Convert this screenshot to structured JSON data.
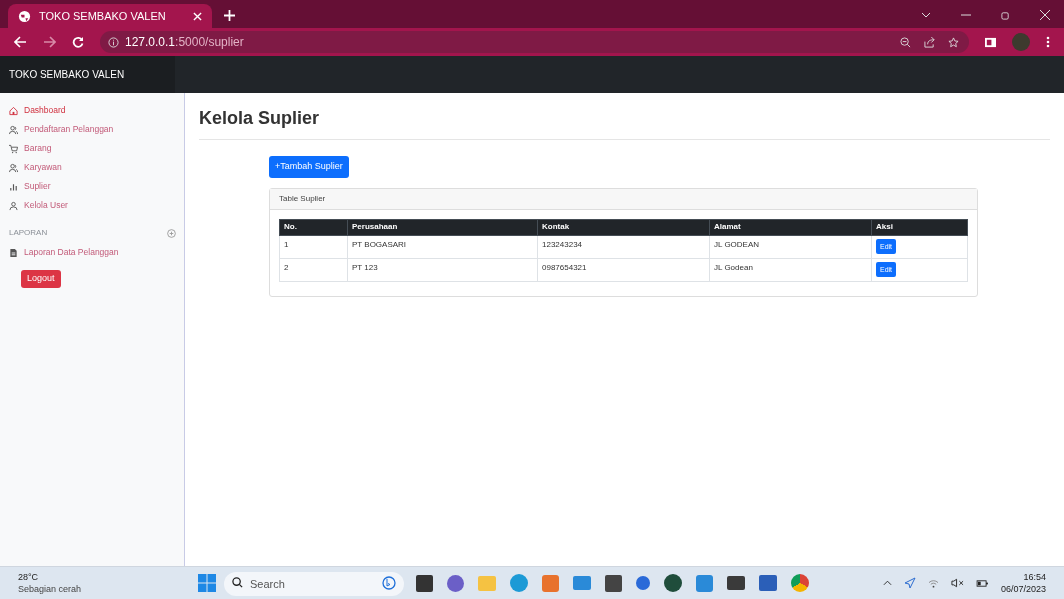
{
  "browser": {
    "tab_title": "TOKO SEMBAKO VALEN",
    "url_host": "127.0.0.1",
    "url_path": ":5000/suplier"
  },
  "navbar": {
    "brand": "TOKO SEMBAKO VALEN"
  },
  "sidebar": {
    "items": [
      {
        "label": "Dashboard",
        "kind": "home",
        "selected": true
      },
      {
        "label": "Pendaftaran Pelanggan",
        "kind": "users",
        "selected": false
      },
      {
        "label": "Barang",
        "kind": "cart",
        "selected": false
      },
      {
        "label": "Karyawan",
        "kind": "users",
        "selected": false
      },
      {
        "label": "Suplier",
        "kind": "chart",
        "selected": false
      },
      {
        "label": "Kelola User",
        "kind": "user",
        "selected": false
      }
    ],
    "section": {
      "heading": "LAPORAN",
      "items": [
        {
          "label": "Laporan Data Pelanggan",
          "kind": "file",
          "selected": false
        }
      ]
    },
    "logout": "Logout"
  },
  "page": {
    "title": "Kelola Suplier",
    "add_button": "+Tambah Suplier",
    "card_title": "Table Suplier",
    "table": {
      "columns": [
        "No.",
        "Perusahaan",
        "Kontak",
        "Alamat",
        "Aksi"
      ],
      "rows": [
        {
          "cells": [
            "1",
            "PT BOGASARI",
            "123243234",
            "JL GODEAN"
          ],
          "action": "Edit"
        },
        {
          "cells": [
            "2",
            "PT 123",
            "0987654321",
            "JL Godean"
          ],
          "action": "Edit"
        }
      ]
    }
  },
  "taskbar": {
    "weather_temp": "28°C",
    "weather_text": "Sebagian cerah",
    "search": {
      "placeholder": "Search"
    },
    "time": "16:54",
    "date": "06/07/2023"
  }
}
